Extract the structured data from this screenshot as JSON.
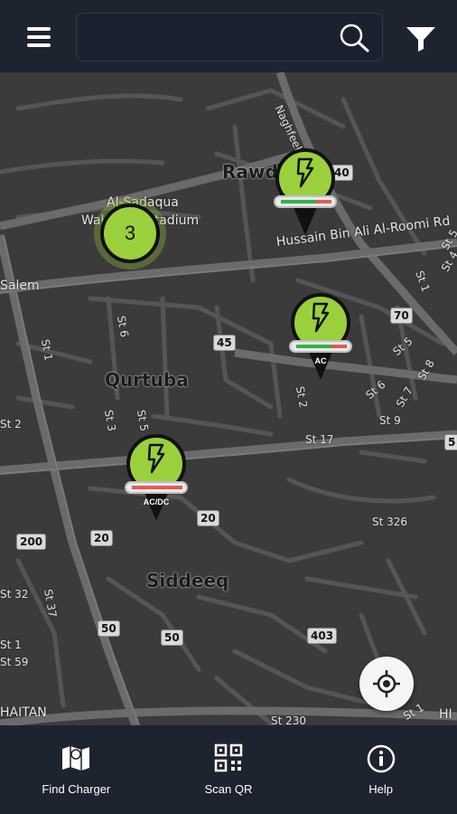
{
  "header": {
    "menu_icon": "hamburger-menu-icon",
    "search_placeholder": "",
    "search_icon": "search-icon",
    "filter_icon": "filter-funnel-icon"
  },
  "map": {
    "area_labels": [
      {
        "name": "rawda",
        "text": "Rawda"
      },
      {
        "name": "qurtuba",
        "text": "Qurtuba"
      },
      {
        "name": "siddeeq",
        "text": "Siddeeq"
      },
      {
        "name": "stadium-line-1",
        "text": "Al-Sadaqua"
      },
      {
        "name": "stadium-line-2",
        "text": "Walsalam Stadium"
      },
      {
        "name": "hussain-road",
        "text": "Hussain Bin Ali Al-Roomi Rd"
      },
      {
        "name": "salem",
        "text": "Salem"
      },
      {
        "name": "haitan",
        "text": "HAITAN"
      },
      {
        "name": "ghaheeb",
        "text": "Naghfeeb St"
      },
      {
        "name": "hitan-right",
        "text": "HI"
      }
    ],
    "street_labels": [
      "St 1",
      "St 6",
      "St 3",
      "St 5",
      "St 2",
      "St 1",
      "St 2",
      "St 6",
      "St 7",
      "St 8",
      "St 5",
      "St 9",
      "St 17",
      "St 326",
      "St 32",
      "St 37",
      "St 59",
      "St 230",
      "St 1",
      "St 1",
      "St 4",
      "St 5"
    ],
    "route_shields": [
      "40",
      "70",
      "45",
      "20",
      "20",
      "200",
      "50",
      "50",
      "403",
      "5"
    ],
    "cluster": {
      "count": "3",
      "color": "#9bd03d"
    },
    "chargers": [
      {
        "name": "charger-rawda",
        "type": "",
        "available_fraction": 0.7
      },
      {
        "name": "charger-ac",
        "type": "AC",
        "available_fraction": 0.7
      },
      {
        "name": "charger-acdc",
        "type": "AC/DC",
        "available_fraction": 0.0
      }
    ],
    "locate_icon": "my-location-icon"
  },
  "bottom_nav": {
    "items": [
      {
        "label": "Find Charger",
        "icon": "map-icon"
      },
      {
        "label": "Scan QR",
        "icon": "qr-code-icon"
      },
      {
        "label": "Help",
        "icon": "info-icon"
      }
    ]
  },
  "colors": {
    "bar_background": "#1e2330",
    "marker_green": "#9bd03d",
    "map_background": "#3a3a3a",
    "available_green": "#2fb24a",
    "busy_red": "#e05a5a"
  }
}
